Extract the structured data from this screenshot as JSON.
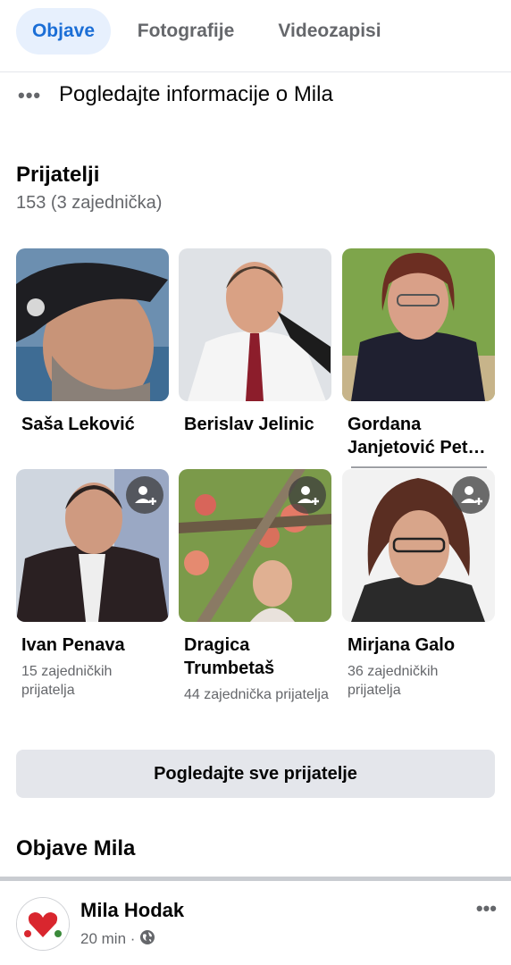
{
  "tabs": [
    {
      "label": "Objave",
      "active": true
    },
    {
      "label": "Fotografije",
      "active": false
    },
    {
      "label": "Videozapisi",
      "active": false
    }
  ],
  "info_link": {
    "more_icon": "•••",
    "text": "Pogledajte informacije o Mila"
  },
  "friends": {
    "title": "Prijatelji",
    "count_text": "153 (3 zajednička)",
    "cards": [
      {
        "name": "Saša Leković",
        "mutual": "",
        "show_add": false
      },
      {
        "name": "Berislav Jelinic",
        "mutual": "",
        "show_add": false
      },
      {
        "name": "Gordana Janjetović Pet…",
        "mutual": "",
        "show_add": false
      },
      {
        "name": "Ivan Penava",
        "mutual": "15 zajedničkih prijatelja",
        "show_add": true
      },
      {
        "name": "Dragica Trumbetaš",
        "mutual": "44 zajednička prijatelja",
        "show_add": true
      },
      {
        "name": "Mirjana Galo",
        "mutual": "36 zajedničkih prijatelja",
        "show_add": true
      }
    ],
    "see_all_label": "Pogledajte sve prijatelje"
  },
  "posts_section": {
    "title": "Objave Mila"
  },
  "post": {
    "author": "Mila Hodak",
    "time": "20 min",
    "separator": "·",
    "audience_icon": "globe-icon",
    "more_icon": "•••"
  },
  "colors": {
    "accent": "#1b6ed6",
    "active_tab_bg": "#e7f0fd",
    "secondary_text": "#65676b",
    "button_bg": "#e4e6eb"
  }
}
